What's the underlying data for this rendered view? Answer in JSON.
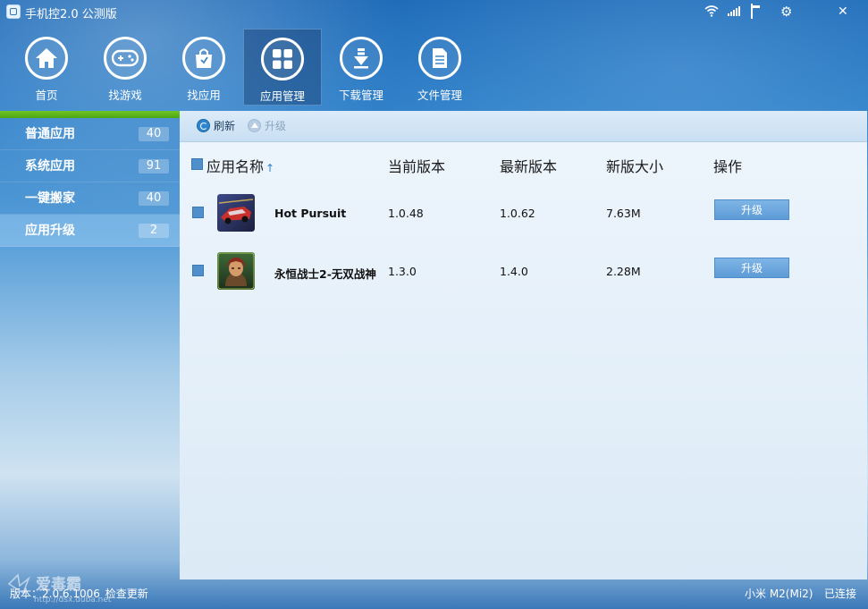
{
  "window": {
    "title": "手机控2.0 公测版",
    "controls": {
      "wifi_icon": "wifi-icon",
      "signal_icon": "signal-icon",
      "battery_icon": "battery-icon",
      "settings_icon": "gear-icon",
      "minimize_icon": "minimize-icon",
      "close_icon": "close-icon"
    }
  },
  "nav": {
    "items": [
      {
        "label": "首页",
        "icon": "home-icon"
      },
      {
        "label": "找游戏",
        "icon": "gamepad-icon"
      },
      {
        "label": "找应用",
        "icon": "shopping-bag-icon"
      },
      {
        "label": "应用管理",
        "icon": "apps-grid-icon",
        "active": true
      },
      {
        "label": "下载管理",
        "icon": "download-icon"
      },
      {
        "label": "文件管理",
        "icon": "document-icon"
      }
    ]
  },
  "sidebar": {
    "accent_color": "#5cb21b",
    "items": [
      {
        "label": "普通应用",
        "count": "40"
      },
      {
        "label": "系统应用",
        "count": "91"
      },
      {
        "label": "一键搬家",
        "count": "40"
      },
      {
        "label": "应用升级",
        "count": "2",
        "active": true
      }
    ]
  },
  "toolbar": {
    "refresh_label": "刷新",
    "upgrade_label": "升级"
  },
  "table": {
    "headers": {
      "name": "应用名称",
      "name_sort": "↑",
      "current_version": "当前版本",
      "latest_version": "最新版本",
      "new_size": "新版大小",
      "action": "操作"
    },
    "rows": [
      {
        "name": "Hot Pursuit",
        "current_version": "1.0.48",
        "latest_version": "1.0.62",
        "new_size": "7.63M",
        "action_label": "升级",
        "icon": "racing-car-app-icon"
      },
      {
        "name": "永恒战士2-无双战神",
        "current_version": "1.3.0",
        "latest_version": "1.4.0",
        "new_size": "2.28M",
        "action_label": "升级",
        "icon": "warrior-app-icon"
      }
    ]
  },
  "status": {
    "version": "版本：2.0.6.1006",
    "check_update": "检查更新",
    "device": "小米 M2(Mi2)",
    "connection": "已连接"
  },
  "watermark": {
    "text": "爱毒霸",
    "url": "http://dsx.duba.net"
  },
  "colors": {
    "accent": "#2b79c2",
    "button": "#6aa8e0",
    "sidebar_active": "#8ec3ea"
  }
}
